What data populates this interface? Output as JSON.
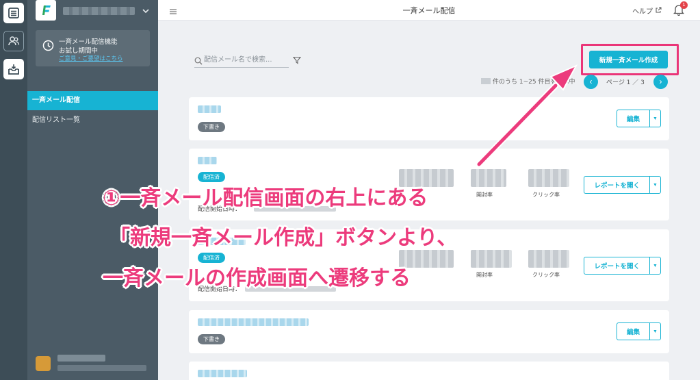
{
  "topbar": {
    "title": "一斉メール配信",
    "help": "ヘルプ",
    "notification_count": "1"
  },
  "sidebar": {
    "trial_line1": "一斉メール配信機能",
    "trial_line2": "お試し期間中",
    "trial_link": "ご意見・ご要望はこちら",
    "items": [
      {
        "label": "一斉メール配信",
        "active": true
      },
      {
        "label": "配信リスト一覧",
        "active": false
      }
    ]
  },
  "search": {
    "placeholder": "配信メール名で検索..."
  },
  "new_button": {
    "label": "新規一斉メール作成"
  },
  "pagination": {
    "count_text": "件のうち 1~25 件目を表示中",
    "page_text": "ページ 1 ／ 3"
  },
  "cards": [
    {
      "status": "下書き",
      "button": "編集"
    },
    {
      "status": "配信済",
      "button": "レポートを開く",
      "metric1": "開封率",
      "metric2": "クリック率",
      "start_label": "配信開始日時："
    },
    {
      "status": "配信済",
      "button": "レポートを開く",
      "metric1": "開封率",
      "metric2": "クリック率",
      "start_label": "配信開始日時："
    },
    {
      "status": "下書き",
      "button": "編集"
    }
  ],
  "annotation": {
    "line1": "①一斉メール配信画面の右上にある",
    "line2": "「新規一斉メール作成」ボタンより、",
    "line3": "一斉メールの作成画面へ遷移する"
  },
  "colors": {
    "accent": "#17b3d3",
    "annotation": "#ec3b7c",
    "sidebar": "#4b5b66"
  }
}
